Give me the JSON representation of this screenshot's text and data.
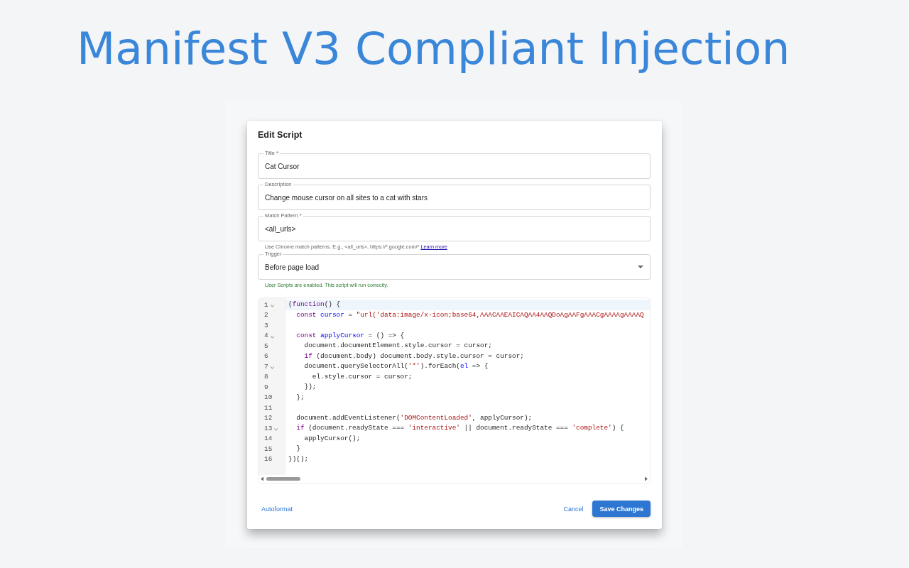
{
  "heading": "Manifest V3 Compliant Injection",
  "dialog": {
    "title": "Edit Script",
    "fields": [
      {
        "kind": "text",
        "label": "Title *",
        "value": "Cat Cursor"
      },
      {
        "kind": "text",
        "label": "Description",
        "value": "Change mouse cursor on all sites to a cat with stars"
      },
      {
        "kind": "text",
        "label": "Match Pattern *",
        "value": "<all_urls>",
        "helper": {
          "success": false,
          "text": "Use Chrome match patterns. E.g., <all_urls>, https://*.google.com/*",
          "link": "Learn more"
        }
      },
      {
        "kind": "select",
        "label": "Trigger",
        "value": "Before page load",
        "helper": {
          "success": true,
          "text": "User Scripts are enabled. This script will run correctly."
        }
      }
    ],
    "editor": {
      "lines": [
        {
          "number": "1",
          "foldable": true,
          "active": true,
          "tokens": [
            {
              "kind": "plain",
              "text": "("
            },
            {
              "kind": "keyword",
              "text": "function"
            },
            {
              "kind": "plain",
              "text": "() {"
            }
          ]
        },
        {
          "number": "2",
          "foldable": false,
          "active": false,
          "tokens": [
            {
              "kind": "keyword",
              "text": "  const"
            },
            {
              "kind": "def",
              "text": " cursor"
            },
            {
              "kind": "plain",
              "text": " = "
            },
            {
              "kind": "string",
              "text": "\"url('data:image/x-icon;base64,AAACAAEAICAQAA4AAQDoAgAAFgAAACgAAAAgAAAAQ"
            }
          ]
        },
        {
          "number": "3",
          "foldable": false,
          "active": false
        },
        {
          "number": "4",
          "foldable": true,
          "active": false,
          "tokens": [
            {
              "kind": "keyword",
              "text": "  const"
            },
            {
              "kind": "def",
              "text": " applyCursor"
            },
            {
              "kind": "plain",
              "text": " = () => {"
            }
          ]
        },
        {
          "number": "5",
          "foldable": false,
          "active": false,
          "tokens": [
            {
              "kind": "plain",
              "text": "    document.documentElement.style.cursor = cursor;"
            }
          ]
        },
        {
          "number": "6",
          "foldable": false,
          "active": false,
          "tokens": [
            {
              "kind": "keyword",
              "text": "    if"
            },
            {
              "kind": "plain",
              "text": " (document.body) document.body.style.cursor = cursor;"
            }
          ]
        },
        {
          "number": "7",
          "foldable": true,
          "active": false,
          "tokens": [
            {
              "kind": "plain",
              "text": "    document.querySelectorAll("
            },
            {
              "kind": "string",
              "text": "'*'"
            },
            {
              "kind": "plain",
              "text": ").forEach("
            },
            {
              "kind": "def",
              "text": "el"
            },
            {
              "kind": "plain",
              "text": " => {"
            }
          ]
        },
        {
          "number": "8",
          "foldable": false,
          "active": false,
          "tokens": [
            {
              "kind": "plain",
              "text": "      el.style.cursor = cursor;"
            }
          ]
        },
        {
          "number": "9",
          "foldable": false,
          "active": false,
          "tokens": [
            {
              "kind": "plain",
              "text": "    });"
            }
          ]
        },
        {
          "number": "10",
          "foldable": false,
          "active": false,
          "tokens": [
            {
              "kind": "plain",
              "text": "  };"
            }
          ]
        },
        {
          "number": "11",
          "foldable": false,
          "active": false
        },
        {
          "number": "12",
          "foldable": false,
          "active": false,
          "tokens": [
            {
              "kind": "plain",
              "text": "  document.addEventListener("
            },
            {
              "kind": "string",
              "text": "'DOMContentLoaded'"
            },
            {
              "kind": "plain",
              "text": ", applyCursor);"
            }
          ]
        },
        {
          "number": "13",
          "foldable": true,
          "active": false,
          "tokens": [
            {
              "kind": "keyword",
              "text": "  if"
            },
            {
              "kind": "plain",
              "text": " (document.readyState === "
            },
            {
              "kind": "string",
              "text": "'interactive'"
            },
            {
              "kind": "plain",
              "text": " || document.readyState === "
            },
            {
              "kind": "string",
              "text": "'complete'"
            },
            {
              "kind": "plain",
              "text": ") {"
            }
          ]
        },
        {
          "number": "14",
          "foldable": false,
          "active": false,
          "tokens": [
            {
              "kind": "plain",
              "text": "    applyCursor();"
            }
          ]
        },
        {
          "number": "15",
          "foldable": false,
          "active": false,
          "tokens": [
            {
              "kind": "plain",
              "text": "  }"
            }
          ]
        },
        {
          "number": "16",
          "foldable": false,
          "active": false,
          "tokens": [
            {
              "kind": "plain",
              "text": "})();"
            }
          ]
        }
      ]
    },
    "actions": {
      "autoformat": "Autoformat",
      "cancel": "Cancel",
      "save": "Save Changes"
    }
  }
}
